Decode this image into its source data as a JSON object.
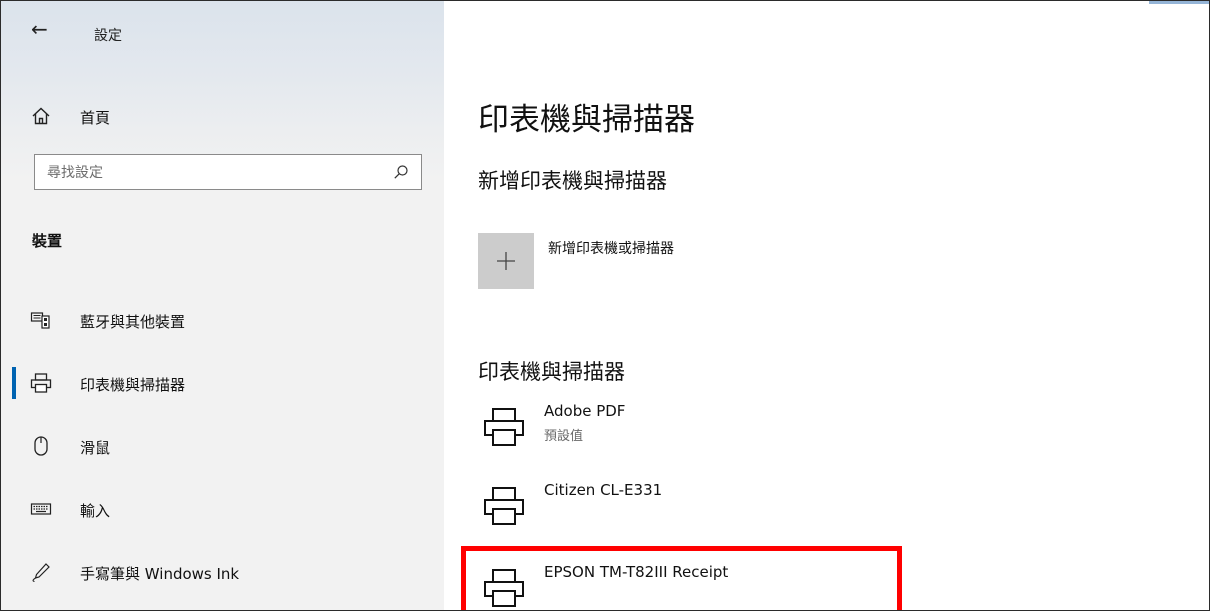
{
  "window": {
    "title": "設定",
    "back_label": "←"
  },
  "sidebar": {
    "home_label": "首頁",
    "search_placeholder": "尋找設定",
    "section_heading": "裝置",
    "items": [
      {
        "label": "藍牙與其他裝置",
        "icon": "bluetooth-devices-icon",
        "selected": false
      },
      {
        "label": "印表機與掃描器",
        "icon": "printer-icon",
        "selected": true
      },
      {
        "label": "滑鼠",
        "icon": "mouse-icon",
        "selected": false
      },
      {
        "label": "輸入",
        "icon": "keyboard-icon",
        "selected": false
      },
      {
        "label": "手寫筆與 Windows Ink",
        "icon": "pen-icon",
        "selected": false
      }
    ]
  },
  "main": {
    "page_title": "印表機與掃描器",
    "add_section_heading": "新增印表機與掃描器",
    "add_button_label": "新增印表機或掃描器",
    "list_heading": "印表機與掃描器",
    "printers": [
      {
        "name": "Adobe PDF",
        "status": "預設值"
      },
      {
        "name": "Citizen CL-E331",
        "status": ""
      },
      {
        "name": "EPSON TM-T82III Receipt",
        "status": ""
      }
    ]
  },
  "colors": {
    "accent": "#0063b1",
    "highlight": "#ff0000",
    "add_tile": "#cccccc"
  }
}
